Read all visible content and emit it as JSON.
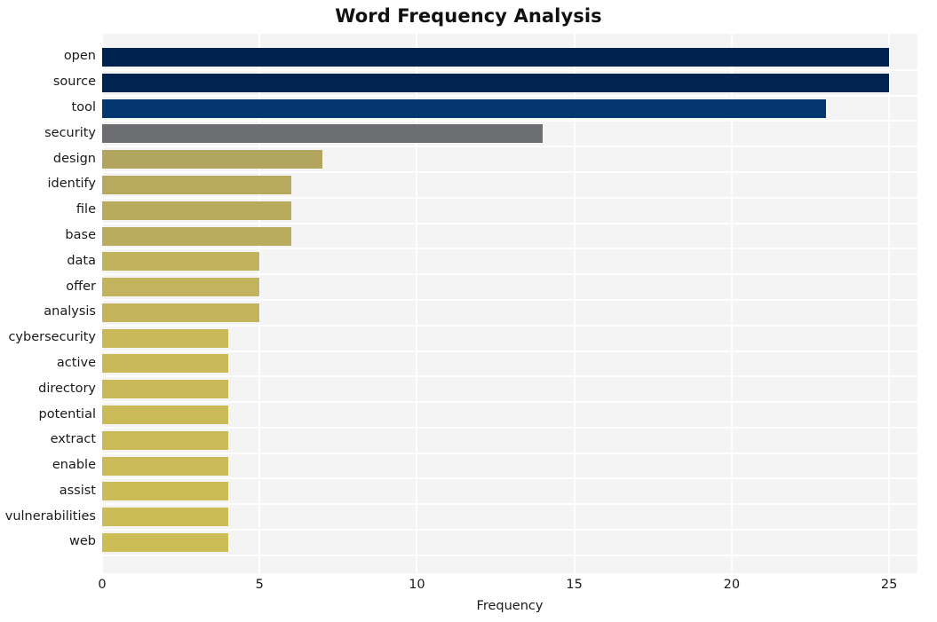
{
  "chart_data": {
    "type": "bar",
    "orientation": "horizontal",
    "title": "Word Frequency Analysis",
    "xlabel": "Frequency",
    "ylabel": "",
    "xlim": [
      0,
      25.9
    ],
    "xticks": [
      0,
      5,
      10,
      15,
      20,
      25
    ],
    "xtick_labels": [
      "0",
      "5",
      "10",
      "15",
      "20",
      "25"
    ],
    "grid": true,
    "grid_axis": "x",
    "legend": "none",
    "categories": [
      "open",
      "source",
      "tool",
      "security",
      "design",
      "identify",
      "file",
      "base",
      "data",
      "offer",
      "analysis",
      "cybersecurity",
      "active",
      "directory",
      "potential",
      "extract",
      "enable",
      "assist",
      "vulnerabilities",
      "web"
    ],
    "values": [
      25,
      25,
      23,
      14,
      7,
      6,
      6,
      6,
      5,
      5,
      5,
      4,
      4,
      4,
      4,
      4,
      4,
      4,
      4,
      4
    ],
    "bar_colors": [
      "#00224e",
      "#00234f",
      "#04376f",
      "#6d6e72",
      "#b1a560",
      "#b7aa5f",
      "#b8ab5e",
      "#b9ac5e",
      "#c1b25c",
      "#c2b35c",
      "#c3b45b",
      "#c9b959",
      "#c9b959",
      "#c9b959",
      "#cabb58",
      "#cabb58",
      "#cabb58",
      "#cbbc57",
      "#cbbc57",
      "#ccbd56"
    ]
  },
  "figure": {
    "background_color": "#ffffff",
    "plot_background_color": "#f4f4f5",
    "gridline_color": "#ffffff",
    "text_color": "#1a1a1a"
  }
}
